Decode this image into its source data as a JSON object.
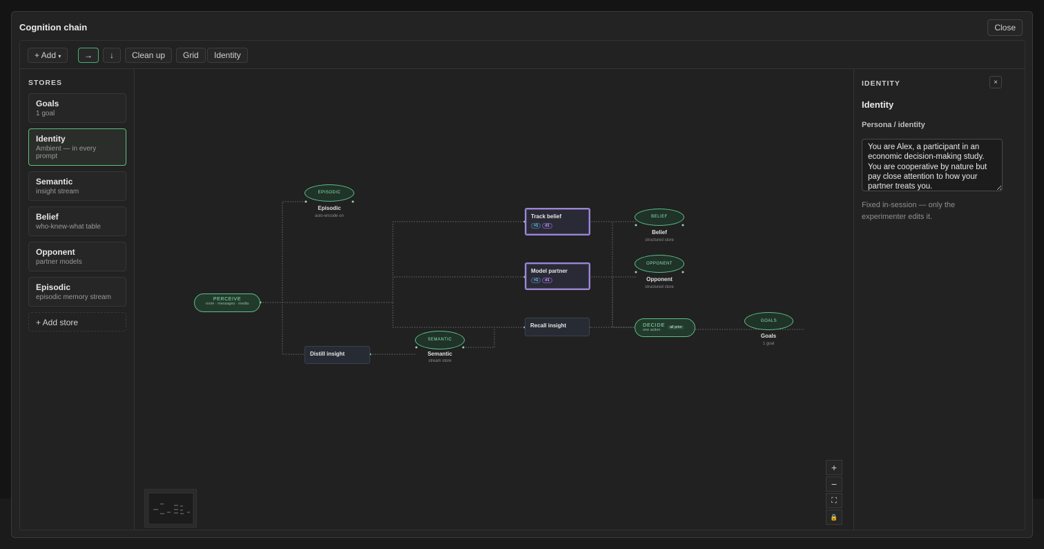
{
  "modal": {
    "title": "Cognition chain",
    "close_label": "Close"
  },
  "toolbar": {
    "add_label": "+ Add",
    "add_caret": "▾",
    "dir_right": "→",
    "dir_down": "↓",
    "cleanup_label": "Clean up",
    "grid_label": "Grid",
    "identity_label": "Identity"
  },
  "sidebar": {
    "heading": "STORES",
    "items": [
      {
        "name": "Goals",
        "sub": "1 goal"
      },
      {
        "name": "Identity",
        "sub": "Ambient — in every prompt"
      },
      {
        "name": "Semantic",
        "sub": "insight stream"
      },
      {
        "name": "Belief",
        "sub": "who-knew-what table"
      },
      {
        "name": "Opponent",
        "sub": "partner models"
      },
      {
        "name": "Episodic",
        "sub": "episodic memory stream"
      }
    ],
    "add_store_label": "+ Add store"
  },
  "graph": {
    "perceive": {
      "title": "PERCEIVE",
      "sub": "room · messages · media"
    },
    "episodic": {
      "tag": "EPISODIC",
      "label": "Episodic",
      "sub": "auto-encode on"
    },
    "distill": {
      "label": "Distill insight"
    },
    "semantic": {
      "tag": "SEMANTIC",
      "label": "Semantic",
      "sub": "stream store"
    },
    "track_belief": {
      "label": "Track belief",
      "chip1": "×1",
      "chip2": "d1"
    },
    "model_partner": {
      "label": "Model partner",
      "chip1": "×1",
      "chip2": "d1"
    },
    "recall": {
      "label": "Recall insight"
    },
    "belief": {
      "tag": "BELIEF",
      "label": "Belief",
      "sub": "structured store"
    },
    "opponent": {
      "tag": "OPPONENT",
      "label": "Opponent",
      "sub": "structured store"
    },
    "decide": {
      "title": "DECIDE",
      "sub": "one action",
      "badge": "all prior"
    },
    "goals": {
      "tag": "GOALS",
      "label": "Goals",
      "sub": "1 goal"
    }
  },
  "zoom_controls": {
    "zoom_in": "+",
    "zoom_out": "−",
    "fit": "⛶",
    "lock": "🔒"
  },
  "panel": {
    "heading": "IDENTITY",
    "close": "×",
    "title": "Identity",
    "field_label": "Persona / identity",
    "persona_text": "You are Alex, a participant in an economic decision-making study. You are cooperative by nature but pay close attention to how your partner treats you.",
    "help": "Fixed in-session — only the experimenter edits it."
  },
  "colors": {
    "accent_green": "#5fbf8a",
    "selected_purple": "#9b87d6",
    "background": "#1e1e1e"
  }
}
